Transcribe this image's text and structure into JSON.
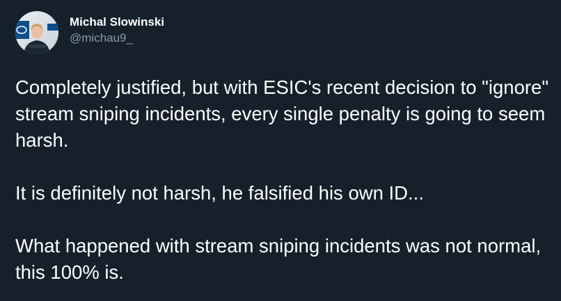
{
  "author": {
    "display_name": "Michal Slowinski",
    "handle": "@michau9_",
    "avatar_icon": "profile-photo"
  },
  "tweet": {
    "paragraphs": [
      "Completely justified, but with ESIC's recent decision to \"ignore\" stream sniping incidents, every single penalty is going to seem harsh.",
      "It is definitely not harsh, he falsified his own ID...",
      "What happened with stream sniping incidents was not normal, this 100% is."
    ]
  },
  "colors": {
    "background": "#15202b",
    "text": "#ffffff",
    "secondary_text": "#8899a6"
  }
}
